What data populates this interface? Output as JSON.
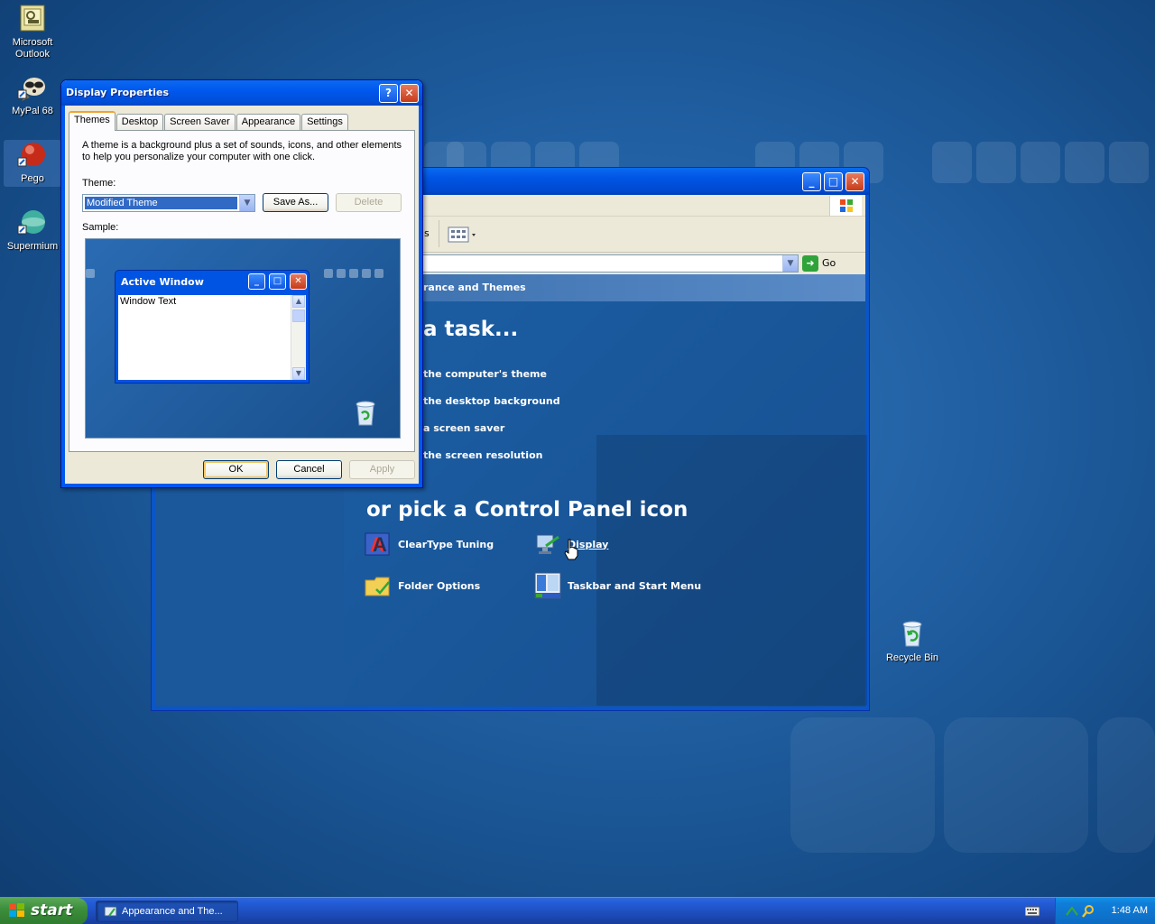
{
  "desktop": {
    "icons": [
      {
        "label": "Microsoft Outlook"
      },
      {
        "label": "MyPal 68"
      },
      {
        "label": "Pego"
      },
      {
        "label": "Supermium"
      },
      {
        "label": "Recycle Bin"
      }
    ]
  },
  "control_panel": {
    "breadcrumb": "rance and Themes",
    "address_go": "Go",
    "task_heading": "a task...",
    "tasks": [
      "the computer's theme",
      "the desktop background",
      "a screen saver",
      "the screen resolution"
    ],
    "pick_heading": "or pick a Control Panel icon",
    "icons": [
      "ClearType Tuning",
      "Display",
      "Folder Options",
      "Taskbar and Start Menu"
    ],
    "toolbar_fragment": "s"
  },
  "dialog": {
    "title": "Display Properties",
    "tabs": [
      "Themes",
      "Desktop",
      "Screen Saver",
      "Appearance",
      "Settings"
    ],
    "description": "A theme is a background plus a set of sounds, icons, and other elements to help you personalize your computer with one click.",
    "theme_label": "Theme:",
    "theme_value": "Modified Theme",
    "save_as": "Save As...",
    "delete": "Delete",
    "sample_label": "Sample:",
    "sample_window_title": "Active Window",
    "sample_window_text": "Window Text",
    "ok": "OK",
    "cancel": "Cancel",
    "apply": "Apply"
  },
  "taskbar": {
    "start": "start",
    "task_button": "Appearance and The...",
    "clock": "1:48 AM"
  }
}
